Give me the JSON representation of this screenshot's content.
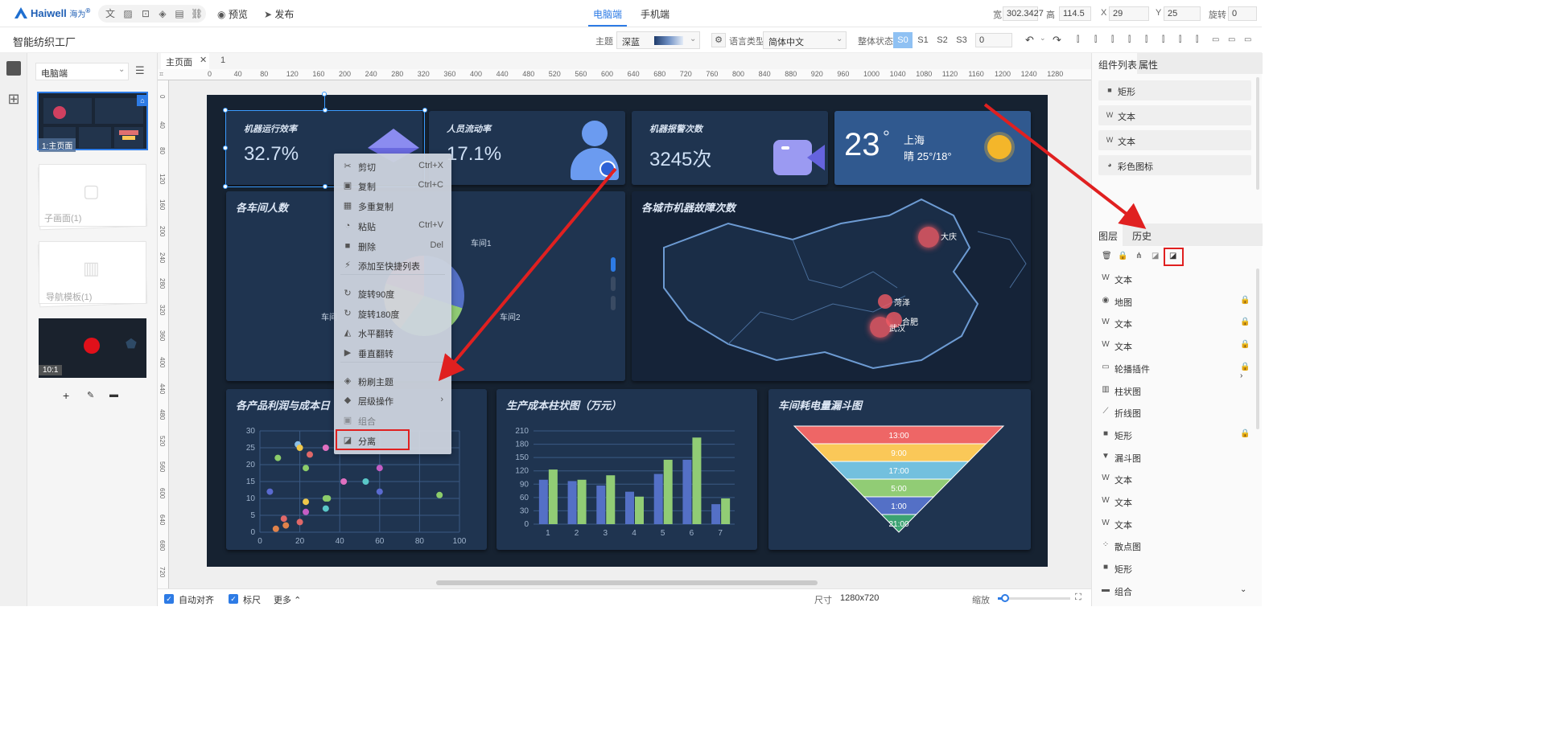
{
  "app": {
    "logo_text": "Haiwell",
    "logo_sub": "海为",
    "logo_tm": "®",
    "project_name": "智能纺织工厂",
    "preview": "预览",
    "publish": "发布",
    "mode_tabs": [
      "电脑端",
      "手机端"
    ],
    "active_mode": "电脑端"
  },
  "props": {
    "w_label": "宽",
    "w": "302.3427",
    "h_label": "高",
    "h": "114.5",
    "x_label": "X",
    "x": "29",
    "y_label": "Y",
    "y": "25",
    "rot_label": "旋转",
    "rot": "0"
  },
  "toolbar": {
    "theme_label": "主题",
    "theme_value": "深蓝",
    "lang_label": "语言类型",
    "lang_value": "简体中文",
    "state_label": "整体状态",
    "states": [
      "S0",
      "S1",
      "S2",
      "S3"
    ],
    "state_input": "0"
  },
  "pages": {
    "device_select": "电脑端",
    "items": [
      {
        "name": "1:主页面"
      },
      {
        "name": "子画面(1)"
      },
      {
        "name": "导航模板(1)"
      },
      {
        "name": "10:1"
      }
    ]
  },
  "tabs": {
    "items": [
      "主页面",
      "1"
    ]
  },
  "ruler": {
    "h": [
      "0",
      "40",
      "80",
      "120",
      "160",
      "200",
      "240",
      "280",
      "320",
      "360",
      "400",
      "440",
      "480",
      "520",
      "560",
      "600",
      "640",
      "680",
      "720",
      "760",
      "800",
      "840",
      "880",
      "920",
      "960",
      "1000",
      "1040",
      "1080",
      "1120",
      "1160",
      "1200",
      "1240",
      "1280"
    ],
    "v": [
      "0",
      "40",
      "80",
      "120",
      "160",
      "200",
      "240",
      "280",
      "320",
      "360",
      "400",
      "440",
      "480",
      "520",
      "560",
      "600",
      "640",
      "680",
      "720"
    ]
  },
  "dashboard": {
    "kpis": [
      {
        "title": "机器运行效率",
        "value": "32.7%"
      },
      {
        "title": "人员流动率",
        "value": "17.1%"
      },
      {
        "title": "机器报警次数",
        "value": "3245次"
      }
    ],
    "weather": {
      "temp": "23",
      "deg": "°",
      "city": "上海",
      "desc": "晴 25°/18°"
    },
    "workshop_people": {
      "title": "各车间人数",
      "labels": [
        "车间1",
        "车间2",
        "车间"
      ]
    },
    "map": {
      "title": "各城市机器故障次数",
      "cities": [
        "大庆",
        "菏泽",
        "合肥",
        "武汉"
      ]
    },
    "scatter_title": "各产品利润与成本日",
    "bar_title": "生产成本柱状图（万元）",
    "funnel_title": "车间耗电量漏斗图"
  },
  "chart_data": [
    {
      "type": "scatter",
      "title": "各产品利润与成本日",
      "xlim": [
        0,
        100
      ],
      "ylim": [
        0,
        30
      ],
      "x_ticks": [
        "0",
        "20",
        "40",
        "60",
        "80",
        "100"
      ],
      "y_ticks": [
        "0",
        "5",
        "10",
        "15",
        "20",
        "25",
        "30"
      ],
      "grid": true,
      "points": [
        {
          "x": 8,
          "y": 1,
          "c": "#e0824a"
        },
        {
          "x": 13,
          "y": 2,
          "c": "#e0824a"
        },
        {
          "x": 12,
          "y": 4,
          "c": "#e06868"
        },
        {
          "x": 20,
          "y": 3,
          "c": "#e06868"
        },
        {
          "x": 23,
          "y": 6,
          "c": "#c45dc4"
        },
        {
          "x": 23,
          "y": 9,
          "c": "#f0c84a"
        },
        {
          "x": 33,
          "y": 7,
          "c": "#5ac8c8"
        },
        {
          "x": 33,
          "y": 10,
          "c": "#8ccc6a"
        },
        {
          "x": 34,
          "y": 10,
          "c": "#8ccc6a"
        },
        {
          "x": 5,
          "y": 12,
          "c": "#5a6ad0"
        },
        {
          "x": 9,
          "y": 22,
          "c": "#8ccc6a"
        },
        {
          "x": 19,
          "y": 26,
          "c": "#8cc0e8"
        },
        {
          "x": 20,
          "y": 25,
          "c": "#f0c84a"
        },
        {
          "x": 23,
          "y": 19,
          "c": "#8ccc6a"
        },
        {
          "x": 25,
          "y": 23,
          "c": "#e06868"
        },
        {
          "x": 33,
          "y": 25,
          "c": "#e070c0"
        },
        {
          "x": 42,
          "y": 15,
          "c": "#e070c0"
        },
        {
          "x": 53,
          "y": 15,
          "c": "#5ac8c8"
        },
        {
          "x": 60,
          "y": 12,
          "c": "#5a6ad0"
        },
        {
          "x": 60,
          "y": 19,
          "c": "#c45dc4"
        },
        {
          "x": 90,
          "y": 11,
          "c": "#8ccc6a"
        }
      ]
    },
    {
      "type": "bar",
      "title": "生产成本柱状图（万元）",
      "categories": [
        "1",
        "2",
        "3",
        "4",
        "5",
        "6",
        "7"
      ],
      "ylim": [
        0,
        210
      ],
      "y_ticks": [
        "0",
        "30",
        "60",
        "90",
        "120",
        "150",
        "180",
        "210"
      ],
      "series": [
        {
          "values": [
            100,
            97,
            87,
            73,
            113,
            145,
            45
          ],
          "color": "#5470c6"
        },
        {
          "values": [
            123,
            100,
            110,
            62,
            145,
            195,
            58
          ],
          "color": "#91cc75"
        }
      ]
    },
    {
      "type": "funnel",
      "title": "车间耗电量漏斗图",
      "stages": [
        {
          "label": "13:00",
          "color": "#ee6666"
        },
        {
          "label": "9:00",
          "color": "#fac858"
        },
        {
          "label": "17:00",
          "color": "#73c0de"
        },
        {
          "label": "5:00",
          "color": "#91cc75"
        },
        {
          "label": "1:00",
          "color": "#5470c6"
        },
        {
          "label": "21:00",
          "color": "#3ba272"
        }
      ]
    }
  ],
  "context_menu": {
    "items": [
      {
        "icon": "cut-icon",
        "glyph": "✂",
        "label": "剪切",
        "shortcut": "Ctrl+X"
      },
      {
        "icon": "copy-icon",
        "glyph": "▣",
        "label": "复制",
        "shortcut": "Ctrl+C"
      },
      {
        "icon": "multi-copy-icon",
        "glyph": "▦",
        "label": "多重复制",
        "shortcut": ""
      },
      {
        "icon": "paste-icon",
        "glyph": "◔",
        "label": "粘贴",
        "shortcut": "Ctrl+V"
      },
      {
        "icon": "delete-icon",
        "glyph": "■",
        "label": "删除",
        "shortcut": "Del"
      },
      {
        "icon": "shortcut-icon",
        "glyph": "⚡",
        "label": "添加至快捷列表",
        "shortcut": ""
      },
      {
        "icon": "rotate90-icon",
        "glyph": "↻",
        "label": "旋转90度",
        "shortcut": ""
      },
      {
        "icon": "rotate180-icon",
        "glyph": "↻",
        "label": "旋转180度",
        "shortcut": ""
      },
      {
        "icon": "flip-h-icon",
        "glyph": "◭",
        "label": "水平翻转",
        "shortcut": ""
      },
      {
        "icon": "flip-v-icon",
        "glyph": "▶",
        "label": "垂直翻转",
        "shortcut": ""
      },
      {
        "icon": "brush-icon",
        "glyph": "◈",
        "label": "粉刷主题",
        "shortcut": ""
      },
      {
        "icon": "layers-icon",
        "glyph": "◆",
        "label": "层级操作",
        "shortcut": "›"
      },
      {
        "icon": "group-icon",
        "glyph": "▣",
        "label": "组合",
        "shortcut": ""
      },
      {
        "icon": "ungroup-icon",
        "glyph": "◪",
        "label": "分离",
        "shortcut": ""
      }
    ]
  },
  "right_panel": {
    "tabs": [
      "组件列表",
      "属性"
    ],
    "components": [
      {
        "icon": "rect-icon",
        "glyph": "■",
        "label": "矩形"
      },
      {
        "icon": "text-icon",
        "glyph": "W",
        "label": "文本"
      },
      {
        "icon": "text-icon",
        "glyph": "W",
        "label": "文本"
      },
      {
        "icon": "color-icon",
        "glyph": "◕",
        "label": "彩色图标"
      }
    ],
    "layer_tabs": [
      "图层",
      "历史"
    ],
    "layers": [
      {
        "icon": "text-icon",
        "glyph": "W",
        "label": "文本",
        "lock": ""
      },
      {
        "icon": "map-icon",
        "glyph": "◉",
        "label": "地图",
        "lock": "🔒"
      },
      {
        "icon": "text-icon",
        "glyph": "W",
        "label": "文本",
        "lock": "🔒"
      },
      {
        "icon": "text-icon",
        "glyph": "W",
        "label": "文本",
        "lock": "🔒"
      },
      {
        "icon": "carousel-icon",
        "glyph": "▭",
        "label": "轮播插件",
        "lock": "🔒 ›"
      },
      {
        "icon": "bar-chart-icon",
        "glyph": "▥",
        "label": "柱状图",
        "lock": ""
      },
      {
        "icon": "line-chart-icon",
        "glyph": "⟋",
        "label": "折线图",
        "lock": ""
      },
      {
        "icon": "rect-icon",
        "glyph": "■",
        "label": "矩形",
        "lock": "🔒"
      },
      {
        "icon": "funnel-icon",
        "glyph": "▼",
        "label": "漏斗图",
        "lock": ""
      },
      {
        "icon": "text-icon",
        "glyph": "W",
        "label": "文本",
        "lock": ""
      },
      {
        "icon": "text-icon",
        "glyph": "W",
        "label": "文本",
        "lock": ""
      },
      {
        "icon": "text-icon",
        "glyph": "W",
        "label": "文本",
        "lock": ""
      },
      {
        "icon": "scatter-icon",
        "glyph": "⁘",
        "label": "散点图",
        "lock": ""
      },
      {
        "icon": "rect-icon",
        "glyph": "■",
        "label": "矩形",
        "lock": ""
      },
      {
        "icon": "folder-icon",
        "glyph": "▬",
        "label": "组合",
        "lock": "⌄"
      }
    ]
  },
  "statusbar": {
    "auto_align": "自动对齐",
    "ruler": "标尺",
    "more": "更多",
    "size_label": "尺寸",
    "size_value": "1280x720",
    "zoom_label": "缩放"
  },
  "colors": {
    "accent": "#2d7be5",
    "highlight_red": "#e02020",
    "canvas_bg": "#162231",
    "panel_bg": "#1f3450"
  }
}
